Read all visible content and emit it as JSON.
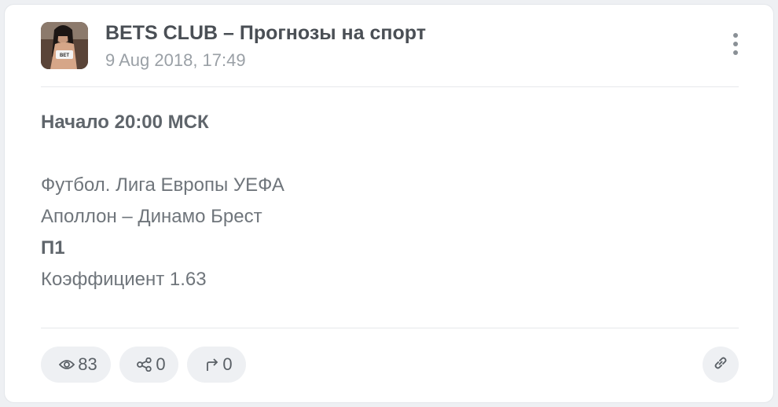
{
  "post": {
    "channel_name": "BETS CLUB – Прогнозы на спорт",
    "date": "9 Aug 2018, 17:49",
    "avatar_text": "BET",
    "body": {
      "start_time": "Начало 20:00 МСК",
      "league": "Футбол. Лига Европы УЕФА",
      "match": "Аполлон – Динамо Брест",
      "bet": "П1",
      "odds": "Коэффициент 1.63"
    },
    "stats": {
      "views": "83",
      "shares": "0",
      "forwards": "0"
    }
  },
  "icons": {
    "menu": "more-vertical-icon",
    "views": "eye-icon",
    "shares": "share-icon",
    "forwards": "forward-arrow-icon",
    "link": "link-icon"
  },
  "colors": {
    "card_background": "#ffffff",
    "page_background": "#eef0f3",
    "title_text": "#4a4f55",
    "muted_text": "#9aa0a6",
    "pill_background": "#eef0f3"
  }
}
